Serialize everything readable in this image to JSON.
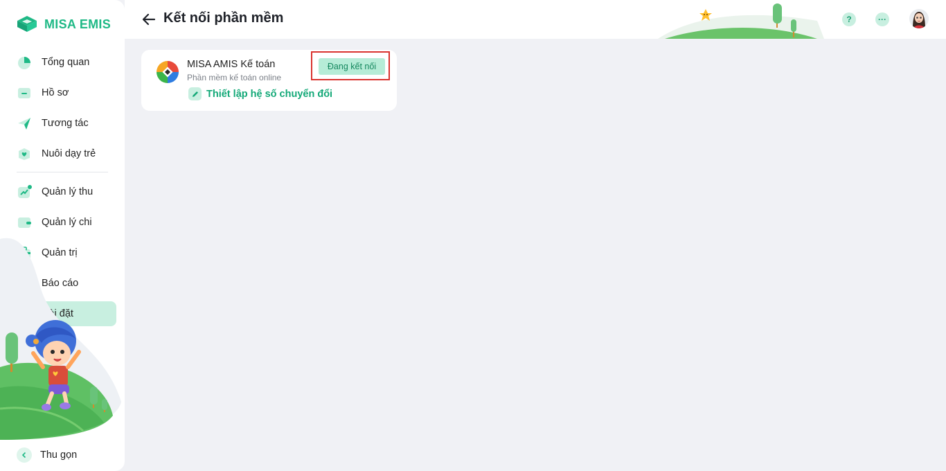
{
  "brand": {
    "name": "MISA EMIS",
    "color": "#1fb986"
  },
  "sidebar": {
    "items": [
      {
        "label": "Tổng quan",
        "icon": "pie-chart-icon"
      },
      {
        "label": "Hồ sơ",
        "icon": "folder-icon"
      },
      {
        "label": "Tương tác",
        "icon": "paper-plane-icon"
      },
      {
        "label": "Nuôi dạy trẻ",
        "icon": "heart-box-icon"
      },
      {
        "label": "Quản lý thu",
        "icon": "income-chart-icon"
      },
      {
        "label": "Quản lý chi",
        "icon": "wallet-icon"
      },
      {
        "label": "Quản trị",
        "icon": "briefcase-icon"
      },
      {
        "label": "Báo cáo",
        "icon": "bar-chart-icon"
      },
      {
        "label": "Cài đặt",
        "icon": "settings-hexagon-icon",
        "active": true
      }
    ],
    "collapse_label": "Thu gọn"
  },
  "header": {
    "title": "Kết nối phần mềm",
    "help_label": "?",
    "more_label": "···"
  },
  "card": {
    "app_name": "MISA AMIS Kế toán",
    "app_subtitle": "Phần mềm kế toán online",
    "status": "Đang kết nối",
    "setup_link": "Thiết lập hệ số chuyển đổi"
  },
  "colors": {
    "accent": "#1fb986",
    "active_bg": "#c8efe0",
    "highlight_border": "#d9322e",
    "page_bg": "#f0f1f5"
  }
}
